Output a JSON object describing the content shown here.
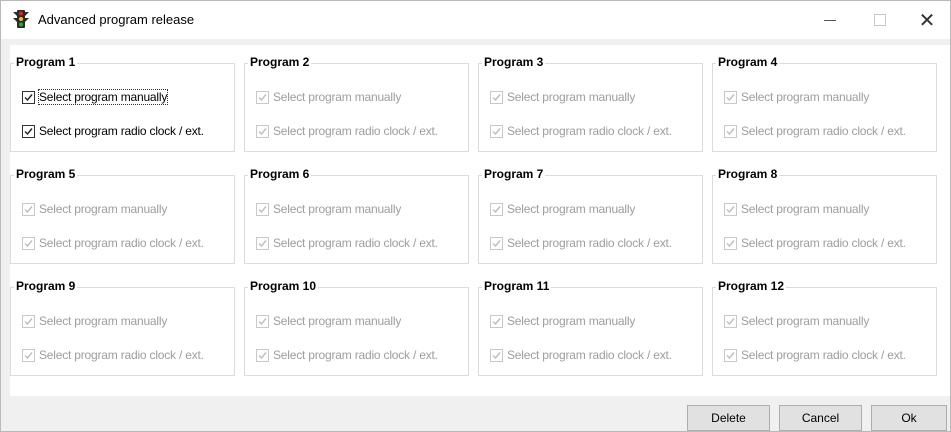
{
  "window": {
    "title": "Advanced program release",
    "icon": "traffic-light-icon"
  },
  "groups": [
    {
      "title": "Program 1",
      "enabled": true,
      "options": [
        {
          "label": "Select program manually",
          "checked": true
        },
        {
          "label": "Select program radio clock / ext.",
          "checked": true
        }
      ]
    },
    {
      "title": "Program 2",
      "enabled": false,
      "options": [
        {
          "label": "Select program manually",
          "checked": true
        },
        {
          "label": "Select program radio clock / ext.",
          "checked": true
        }
      ]
    },
    {
      "title": "Program 3",
      "enabled": false,
      "options": [
        {
          "label": "Select program manually",
          "checked": true
        },
        {
          "label": "Select program radio clock / ext.",
          "checked": true
        }
      ]
    },
    {
      "title": "Program 4",
      "enabled": false,
      "options": [
        {
          "label": "Select program manually",
          "checked": true
        },
        {
          "label": "Select program radio clock / ext.",
          "checked": true
        }
      ]
    },
    {
      "title": "Program 5",
      "enabled": false,
      "options": [
        {
          "label": "Select program manually",
          "checked": true
        },
        {
          "label": "Select program radio clock / ext.",
          "checked": true
        }
      ]
    },
    {
      "title": "Program 6",
      "enabled": false,
      "options": [
        {
          "label": "Select program manually",
          "checked": true
        },
        {
          "label": "Select program radio clock / ext.",
          "checked": true
        }
      ]
    },
    {
      "title": "Program 7",
      "enabled": false,
      "options": [
        {
          "label": "Select program manually",
          "checked": true
        },
        {
          "label": "Select program radio clock / ext.",
          "checked": true
        }
      ]
    },
    {
      "title": "Program 8",
      "enabled": false,
      "options": [
        {
          "label": "Select program manually",
          "checked": true
        },
        {
          "label": "Select program radio clock / ext.",
          "checked": true
        }
      ]
    },
    {
      "title": "Program 9",
      "enabled": false,
      "options": [
        {
          "label": "Select program manually",
          "checked": true
        },
        {
          "label": "Select program radio clock / ext.",
          "checked": true
        }
      ]
    },
    {
      "title": "Program 10",
      "enabled": false,
      "options": [
        {
          "label": "Select program manually",
          "checked": true
        },
        {
          "label": "Select program radio clock / ext.",
          "checked": true
        }
      ]
    },
    {
      "title": "Program 11",
      "enabled": false,
      "options": [
        {
          "label": "Select program manually",
          "checked": true
        },
        {
          "label": "Select program radio clock / ext.",
          "checked": true
        }
      ]
    },
    {
      "title": "Program 12",
      "enabled": false,
      "options": [
        {
          "label": "Select program manually",
          "checked": true
        },
        {
          "label": "Select program radio clock / ext.",
          "checked": true
        }
      ]
    }
  ],
  "buttons": {
    "delete": "Delete",
    "cancel": "Cancel",
    "ok": "Ok"
  }
}
